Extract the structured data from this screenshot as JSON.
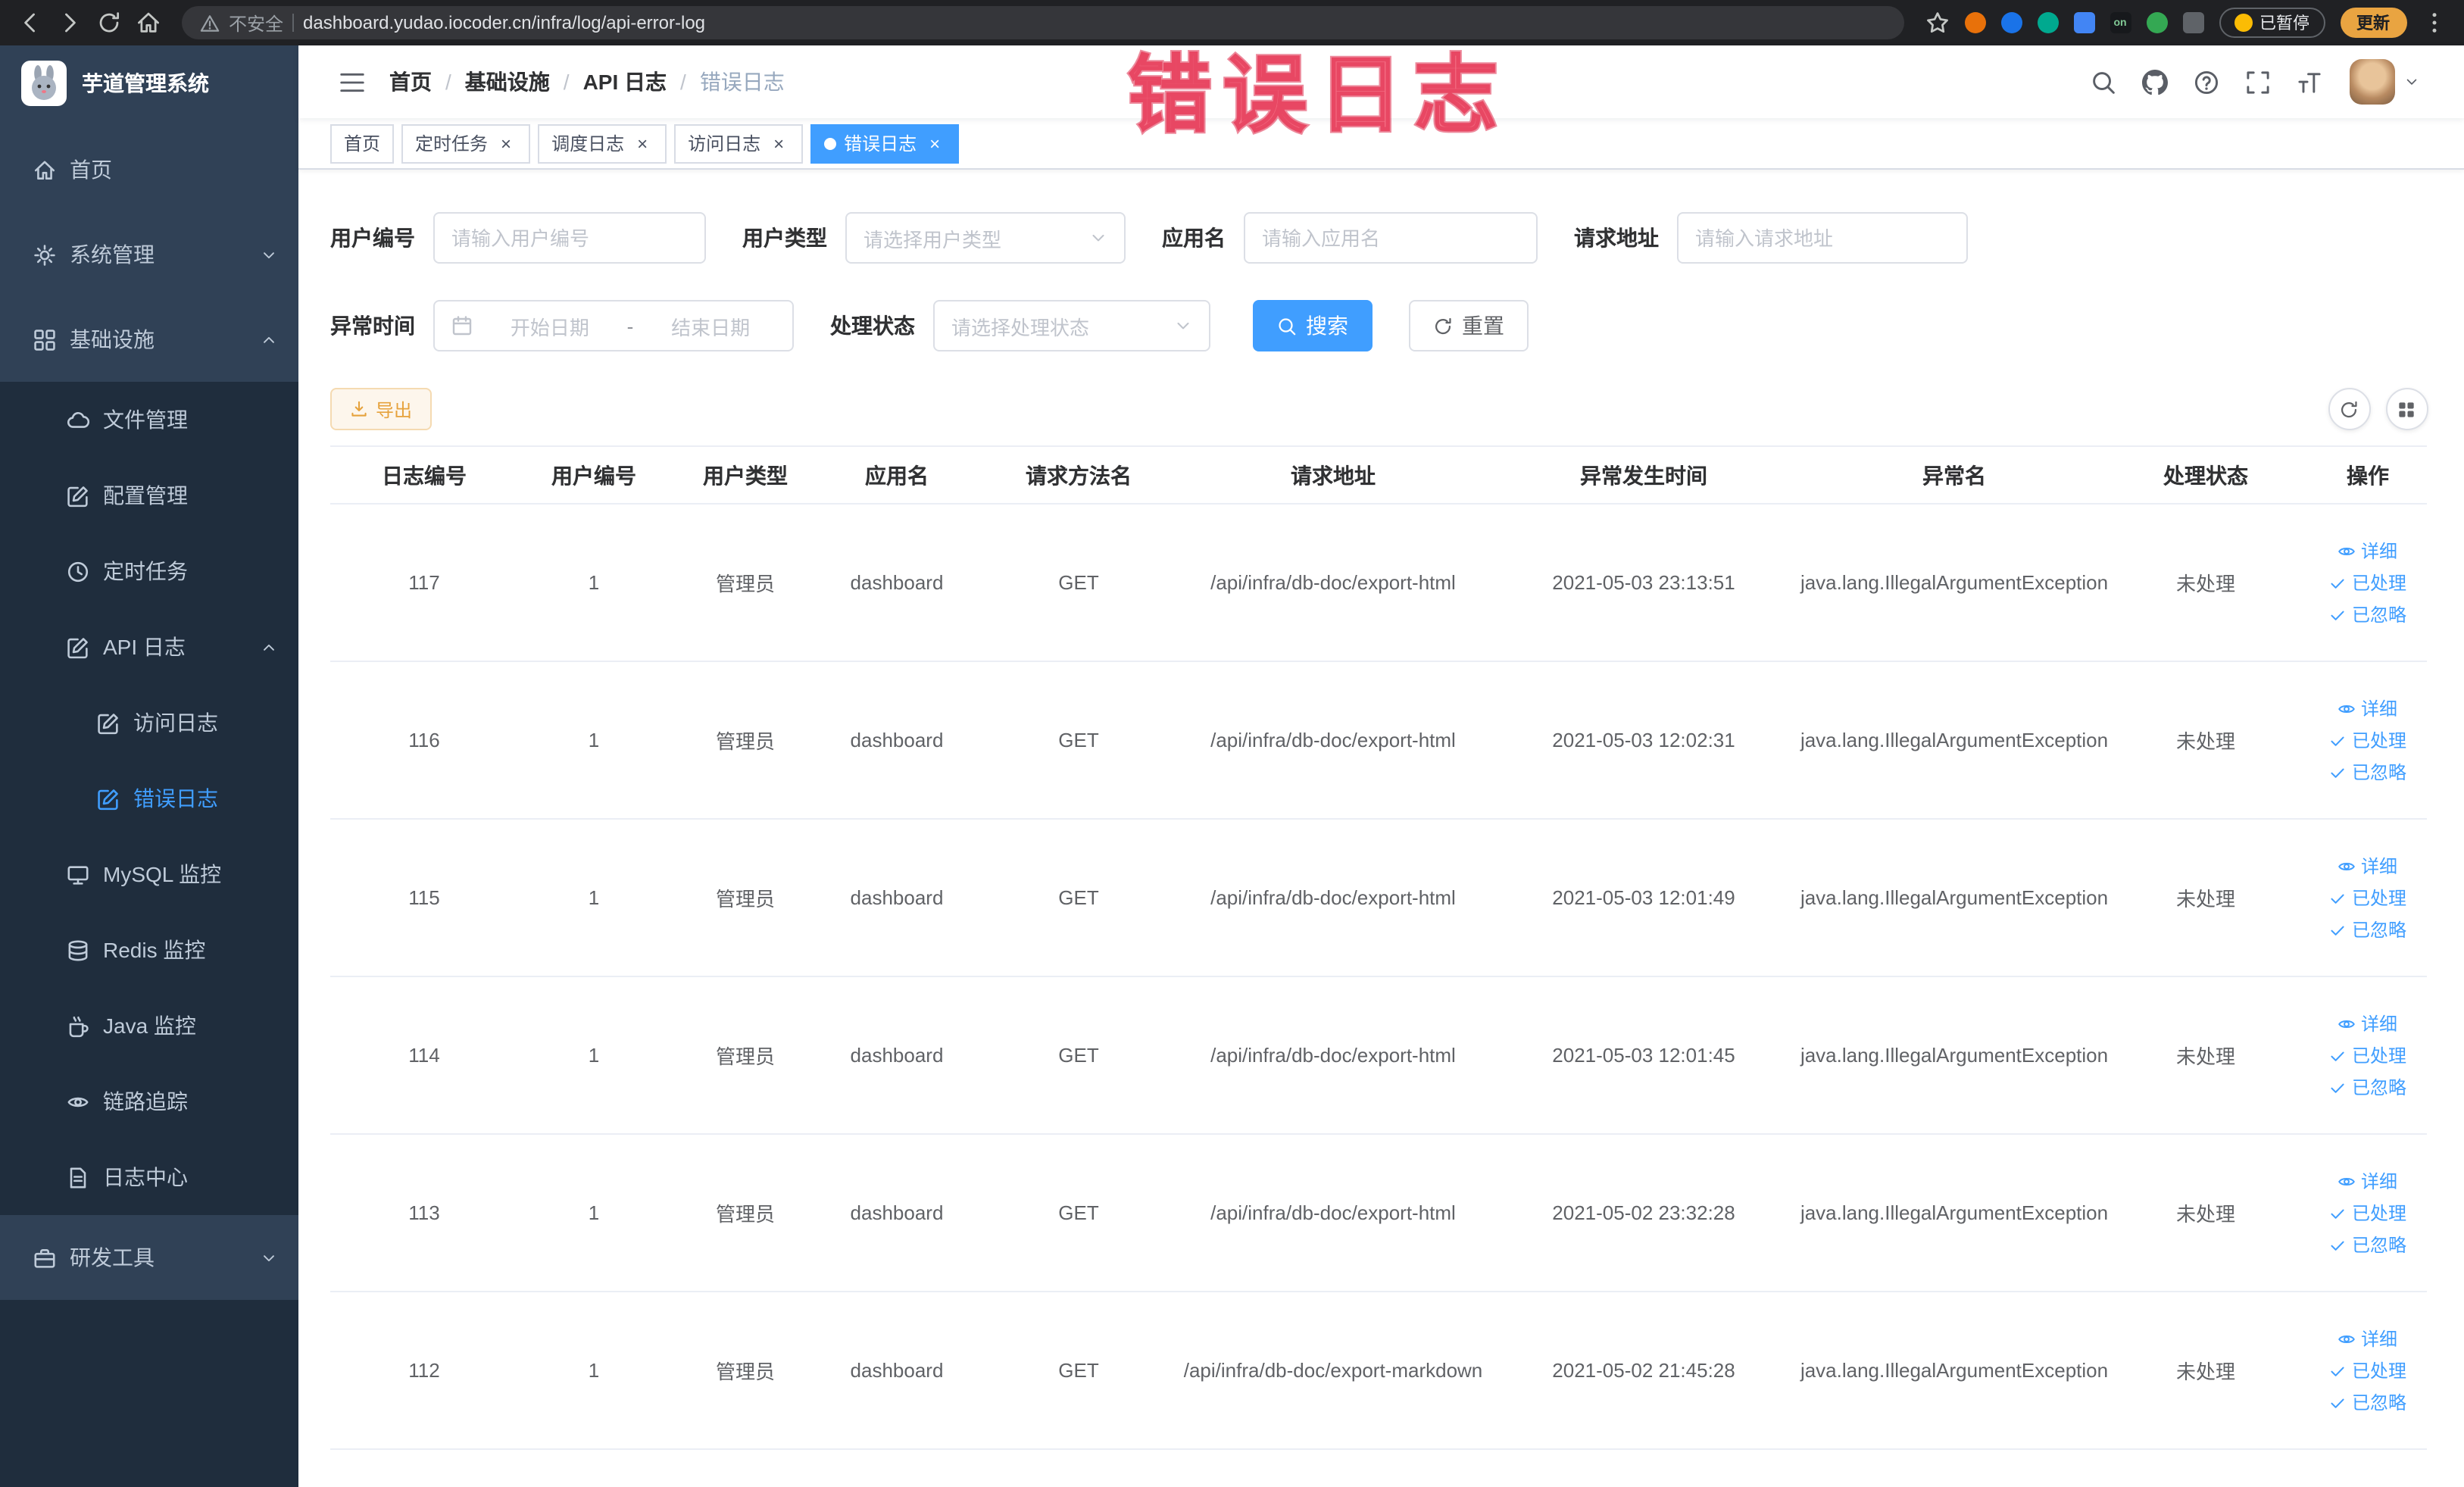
{
  "browser": {
    "security_label": "不安全",
    "url": "dashboard.yudao.iocoder.cn/infra/log/api-error-log",
    "ext_on_label": "on",
    "paused_label": "已暂停",
    "update_label": "更新"
  },
  "overlay": {
    "text": "错误日志"
  },
  "sidebar": {
    "logo_title": "芋道管理系统",
    "menu": [
      {
        "key": "home",
        "label": "首页",
        "icon": "home-icon",
        "level": 1
      },
      {
        "key": "system",
        "label": "系统管理",
        "icon": "gear-icon",
        "level": 1,
        "arrow": "down"
      },
      {
        "key": "infra",
        "label": "基础设施",
        "icon": "infra-icon",
        "level": 1,
        "arrow": "up"
      },
      {
        "key": "file-manage",
        "label": "文件管理",
        "icon": "cloud-icon",
        "level": 2
      },
      {
        "key": "config-manage",
        "label": "配置管理",
        "icon": "edit-icon",
        "level": 2
      },
      {
        "key": "scheduled-job",
        "label": "定时任务",
        "icon": "clock-icon",
        "level": 2
      },
      {
        "key": "api-log",
        "label": "API 日志",
        "icon": "edit-icon",
        "level": 2,
        "arrow": "up"
      },
      {
        "key": "access-log",
        "label": "访问日志",
        "icon": "edit-icon",
        "level": 3
      },
      {
        "key": "error-log",
        "label": "错误日志",
        "icon": "edit-icon",
        "level": 3,
        "active": true
      },
      {
        "key": "mysql-monitor",
        "label": "MySQL 监控",
        "icon": "monitor-icon",
        "level": 2
      },
      {
        "key": "redis-monitor",
        "label": "Redis 监控",
        "icon": "database-icon",
        "level": 2
      },
      {
        "key": "java-monitor",
        "label": "Java 监控",
        "icon": "coffee-icon",
        "level": 2
      },
      {
        "key": "trace",
        "label": "链路追踪",
        "icon": "eye-icon",
        "level": 2
      },
      {
        "key": "log-center",
        "label": "日志中心",
        "icon": "doc-icon",
        "level": 2
      },
      {
        "key": "dev-tools",
        "label": "研发工具",
        "icon": "toolbox-icon",
        "level": 1,
        "arrow": "down"
      }
    ]
  },
  "header": {
    "breadcrumb": [
      "首页",
      "基础设施",
      "API 日志",
      "错误日志"
    ],
    "tools": [
      "search-icon",
      "github-icon",
      "help-icon",
      "fullscreen-icon",
      "font-size-icon"
    ]
  },
  "tags": [
    {
      "label": "首页",
      "closable": false,
      "active": false
    },
    {
      "label": "定时任务",
      "closable": true,
      "active": false
    },
    {
      "label": "调度日志",
      "closable": true,
      "active": false
    },
    {
      "label": "访问日志",
      "closable": true,
      "active": false
    },
    {
      "label": "错误日志",
      "closable": true,
      "active": true
    }
  ],
  "filters": {
    "user_id": {
      "label": "用户编号",
      "placeholder": "请输入用户编号"
    },
    "user_type": {
      "label": "用户类型",
      "placeholder": "请选择用户类型"
    },
    "app_name": {
      "label": "应用名",
      "placeholder": "请输入应用名"
    },
    "request_url": {
      "label": "请求地址",
      "placeholder": "请输入请求地址"
    },
    "exception_time": {
      "label": "异常时间",
      "start_placeholder": "开始日期",
      "separator": "-",
      "end_placeholder": "结束日期"
    },
    "process_status": {
      "label": "处理状态",
      "placeholder": "请选择处理状态"
    },
    "search_label": "搜索",
    "reset_label": "重置"
  },
  "toolbar": {
    "export_label": "导出"
  },
  "table": {
    "columns": [
      "日志编号",
      "用户编号",
      "用户类型",
      "应用名",
      "请求方法名",
      "请求地址",
      "异常发生时间",
      "异常名",
      "处理状态",
      "操作"
    ],
    "row_actions": [
      {
        "name": "detail",
        "label": "详细",
        "icon": "view-icon"
      },
      {
        "name": "processed",
        "label": "已处理",
        "icon": "check-icon"
      },
      {
        "name": "ignore",
        "label": "已忽略",
        "icon": "check-icon"
      }
    ],
    "rows": [
      {
        "id": "117",
        "user_id": "1",
        "user_type": "管理员",
        "app": "dashboard",
        "method": "GET",
        "url": "/api/infra/db-doc/export-html",
        "time": "2021-05-03 23:13:51",
        "exception": "java.lang.IllegalArgumentException",
        "status": "未处理"
      },
      {
        "id": "116",
        "user_id": "1",
        "user_type": "管理员",
        "app": "dashboard",
        "method": "GET",
        "url": "/api/infra/db-doc/export-html",
        "time": "2021-05-03 12:02:31",
        "exception": "java.lang.IllegalArgumentException",
        "status": "未处理"
      },
      {
        "id": "115",
        "user_id": "1",
        "user_type": "管理员",
        "app": "dashboard",
        "method": "GET",
        "url": "/api/infra/db-doc/export-html",
        "time": "2021-05-03 12:01:49",
        "exception": "java.lang.IllegalArgumentException",
        "status": "未处理"
      },
      {
        "id": "114",
        "user_id": "1",
        "user_type": "管理员",
        "app": "dashboard",
        "method": "GET",
        "url": "/api/infra/db-doc/export-html",
        "time": "2021-05-03 12:01:45",
        "exception": "java.lang.IllegalArgumentException",
        "status": "未处理"
      },
      {
        "id": "113",
        "user_id": "1",
        "user_type": "管理员",
        "app": "dashboard",
        "method": "GET",
        "url": "/api/infra/db-doc/export-html",
        "time": "2021-05-02 23:32:28",
        "exception": "java.lang.IllegalArgumentException",
        "status": "未处理"
      },
      {
        "id": "112",
        "user_id": "1",
        "user_type": "管理员",
        "app": "dashboard",
        "method": "GET",
        "url": "/api/infra/db-doc/export-markdown",
        "time": "2021-05-02 21:45:28",
        "exception": "java.lang.IllegalArgumentException",
        "status": "未处理"
      }
    ]
  }
}
